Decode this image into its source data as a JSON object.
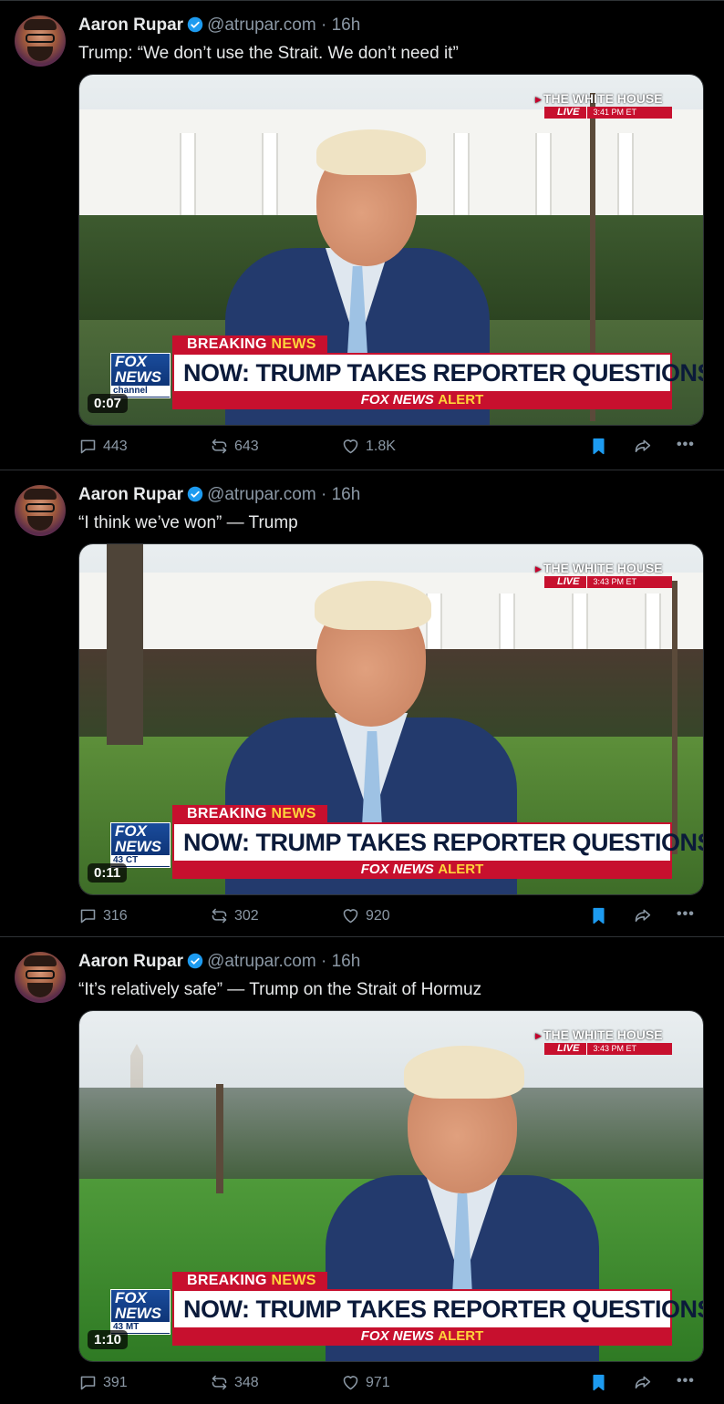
{
  "posts": [
    {
      "author": "Aaron Rupar",
      "handle": "@atrupar.com",
      "time": "16h",
      "text": "Trump: “We don’t use the Strait. We don’t need it”",
      "video": {
        "location": "THE WHITE HOUSE",
        "live": "LIVE",
        "clock": "3:41 PM ET",
        "breaking_prefix": "BREAKING",
        "breaking_suffix": "NEWS",
        "headline": "NOW: TRUMP TAKES REPORTER QUESTIONS",
        "alert_prefix": "FOX NEWS",
        "alert_suffix": "ALERT",
        "logo_top": "FOX",
        "logo_mid": "NEWS",
        "logo_sub": "channel",
        "timer": "0:07"
      },
      "replies": "443",
      "reposts": "643",
      "likes": "1.8K"
    },
    {
      "author": "Aaron Rupar",
      "handle": "@atrupar.com",
      "time": "16h",
      "text": "“I think we’ve won” — Trump",
      "video": {
        "location": "THE WHITE HOUSE",
        "live": "LIVE",
        "clock": "3:43 PM ET",
        "breaking_prefix": "BREAKING",
        "breaking_suffix": "NEWS",
        "headline": "NOW: TRUMP TAKES REPORTER QUESTIONS",
        "alert_prefix": "FOX NEWS",
        "alert_suffix": "ALERT",
        "logo_top": "FOX",
        "logo_mid": "NEWS",
        "logo_sub": "43 CT",
        "timer": "0:11"
      },
      "replies": "316",
      "reposts": "302",
      "likes": "920"
    },
    {
      "author": "Aaron Rupar",
      "handle": "@atrupar.com",
      "time": "16h",
      "text": "“It’s relatively safe” — Trump on the Strait of Hormuz",
      "video": {
        "location": "THE WHITE HOUSE",
        "live": "LIVE",
        "clock": "3:43 PM ET",
        "breaking_prefix": "BREAKING",
        "breaking_suffix": "NEWS",
        "headline": "NOW: TRUMP TAKES REPORTER QUESTIONS",
        "alert_prefix": "FOX NEWS",
        "alert_suffix": "ALERT",
        "logo_top": "FOX",
        "logo_mid": "NEWS",
        "logo_sub": "43 MT",
        "timer": "1:10"
      },
      "replies": "391",
      "reposts": "348",
      "likes": "971"
    }
  ],
  "separator": "·",
  "more_label": "•••",
  "icons": {
    "reply": "reply-icon",
    "repost": "repost-icon",
    "like": "heart-icon",
    "bookmark": "bookmark-icon",
    "share": "share-icon",
    "more": "more-icon",
    "verified": "verified-badge-icon"
  },
  "colors": {
    "background": "#000000",
    "text": "#e7e9ea",
    "muted": "#8b98a5",
    "accent": "#1d9bf0",
    "fox_red": "#c7102e"
  }
}
